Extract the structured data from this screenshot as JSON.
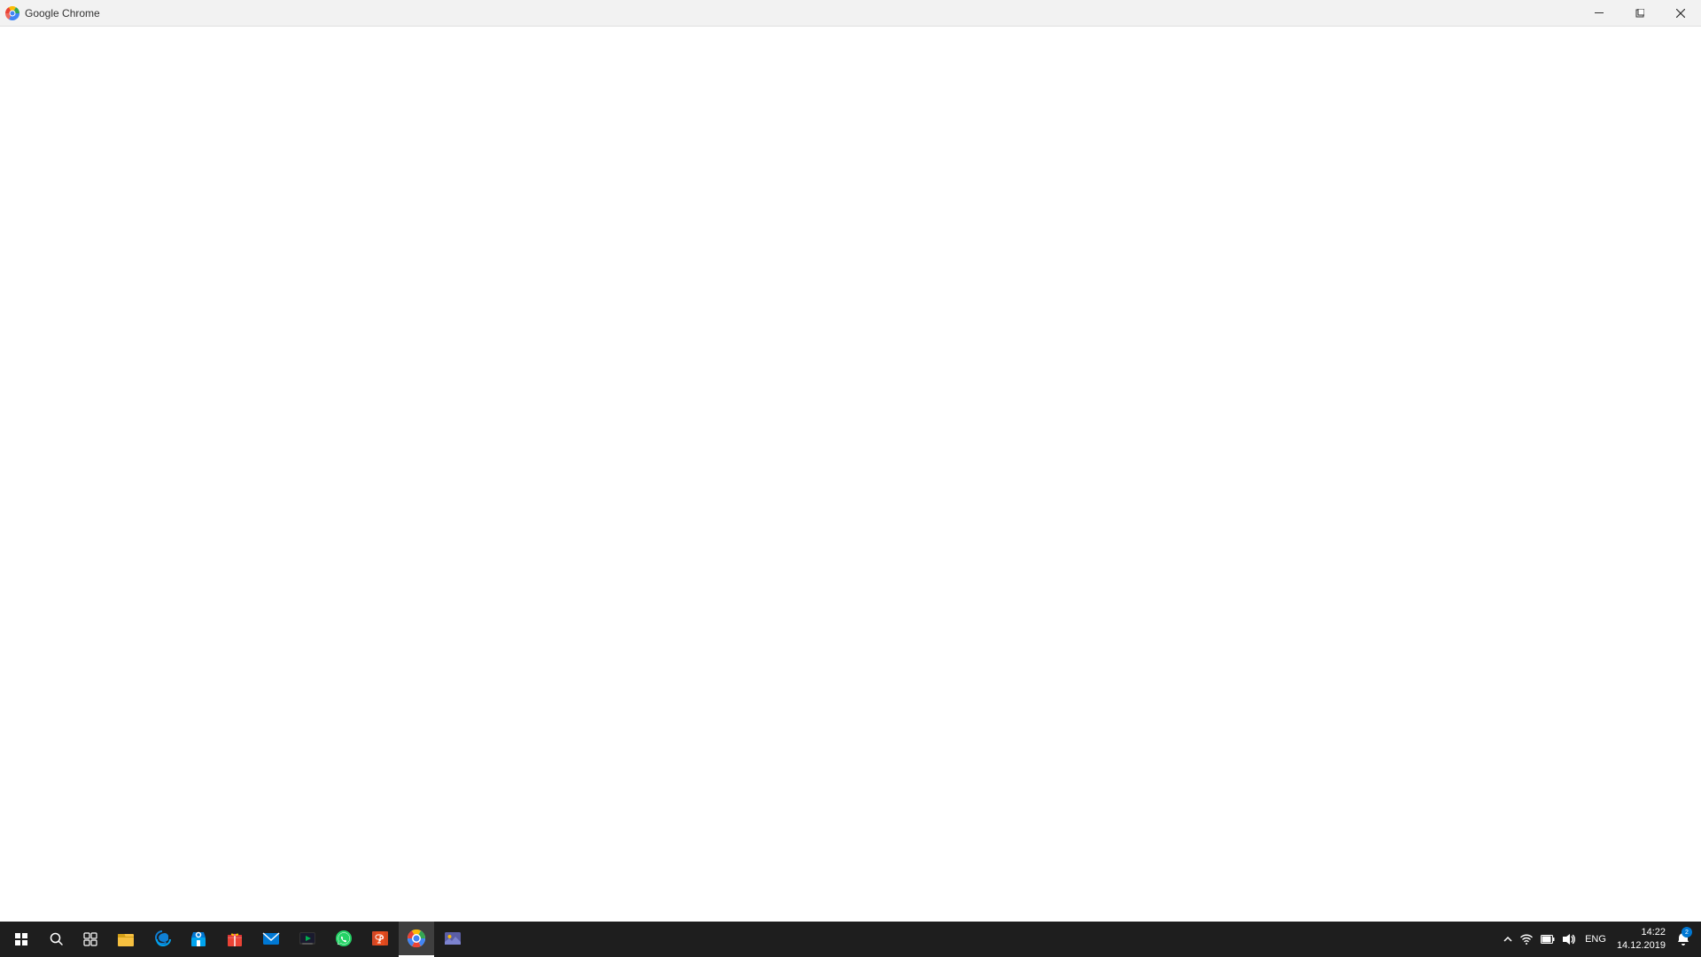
{
  "titlebar": {
    "title": "Google Chrome",
    "minimize_label": "Minimize",
    "maximize_label": "Maximize",
    "close_label": "Close"
  },
  "taskbar": {
    "clock": {
      "time": "14:22",
      "date": "14.12.2019"
    },
    "language": "ENG",
    "notification_count": "2",
    "apps": [
      {
        "name": "file-explorer",
        "label": "File Explorer",
        "active": false
      },
      {
        "name": "edge",
        "label": "Microsoft Edge",
        "active": false
      },
      {
        "name": "store",
        "label": "Microsoft Store",
        "active": false
      },
      {
        "name": "gift",
        "label": "Gift / Promo",
        "active": false
      },
      {
        "name": "mail",
        "label": "Mail",
        "active": false
      },
      {
        "name": "media",
        "label": "Media Player",
        "active": false
      },
      {
        "name": "whatsapp",
        "label": "WhatsApp",
        "active": false
      },
      {
        "name": "powerpoint",
        "label": "PowerPoint",
        "active": false
      },
      {
        "name": "chrome",
        "label": "Google Chrome",
        "active": true
      },
      {
        "name": "photos",
        "label": "Photos",
        "active": false
      }
    ]
  }
}
